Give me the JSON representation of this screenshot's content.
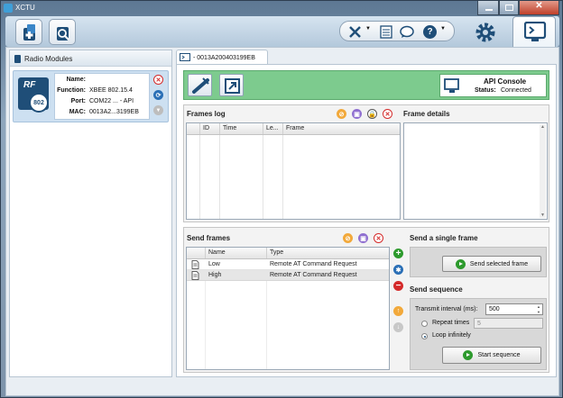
{
  "window": {
    "title": "XCTU",
    "close_glyph": "✕"
  },
  "toolbar": {
    "add_device_icon": "add-device-icon",
    "discover_icon": "discover-devices-icon",
    "tools_icon": "tools-icon",
    "config_icon": "configuration-icon",
    "feedback_icon": "feedback-icon",
    "help_label": "?",
    "settings_icon": "gear-icon",
    "console_icon": "console-icon"
  },
  "sidebar": {
    "title": "Radio Modules",
    "module": {
      "badge_text": "RF",
      "badge_sub": "802",
      "fields": [
        {
          "label": "Name:",
          "value": ""
        },
        {
          "label": "Function:",
          "value": "XBEE 802.15.4"
        },
        {
          "label": "Port:",
          "value": "COM22 ... - API"
        },
        {
          "label": "MAC:",
          "value": "0013A2...3199EB"
        }
      ]
    }
  },
  "tab": {
    "label": "- 0013A200403199EB"
  },
  "api": {
    "title": "API Console",
    "status_label": "Status:",
    "status_value": "Connected"
  },
  "frames_log": {
    "title": "Frames log",
    "columns": [
      "ID",
      "Time",
      "Le...",
      "Frame"
    ],
    "details_title": "Frame details"
  },
  "send_frames": {
    "title": "Send frames",
    "columns": [
      "Name",
      "Type"
    ],
    "rows": [
      {
        "name": "Low",
        "type": "Remote AT Command Request"
      },
      {
        "name": "High",
        "type": "Remote AT Command Request"
      }
    ]
  },
  "single_frame": {
    "title": "Send a single frame",
    "button": "Send selected frame"
  },
  "sequence": {
    "title": "Send sequence",
    "interval_label": "Transmit interval (ms):",
    "interval_value": "500",
    "repeat_label": "Repeat times",
    "repeat_value": "5",
    "loop_label": "Loop infinitely",
    "button": "Start sequence"
  },
  "colors": {
    "accent_green": "#7dcb8e",
    "close_red": "#d42a2a",
    "link_blue": "#2a6fb6"
  }
}
